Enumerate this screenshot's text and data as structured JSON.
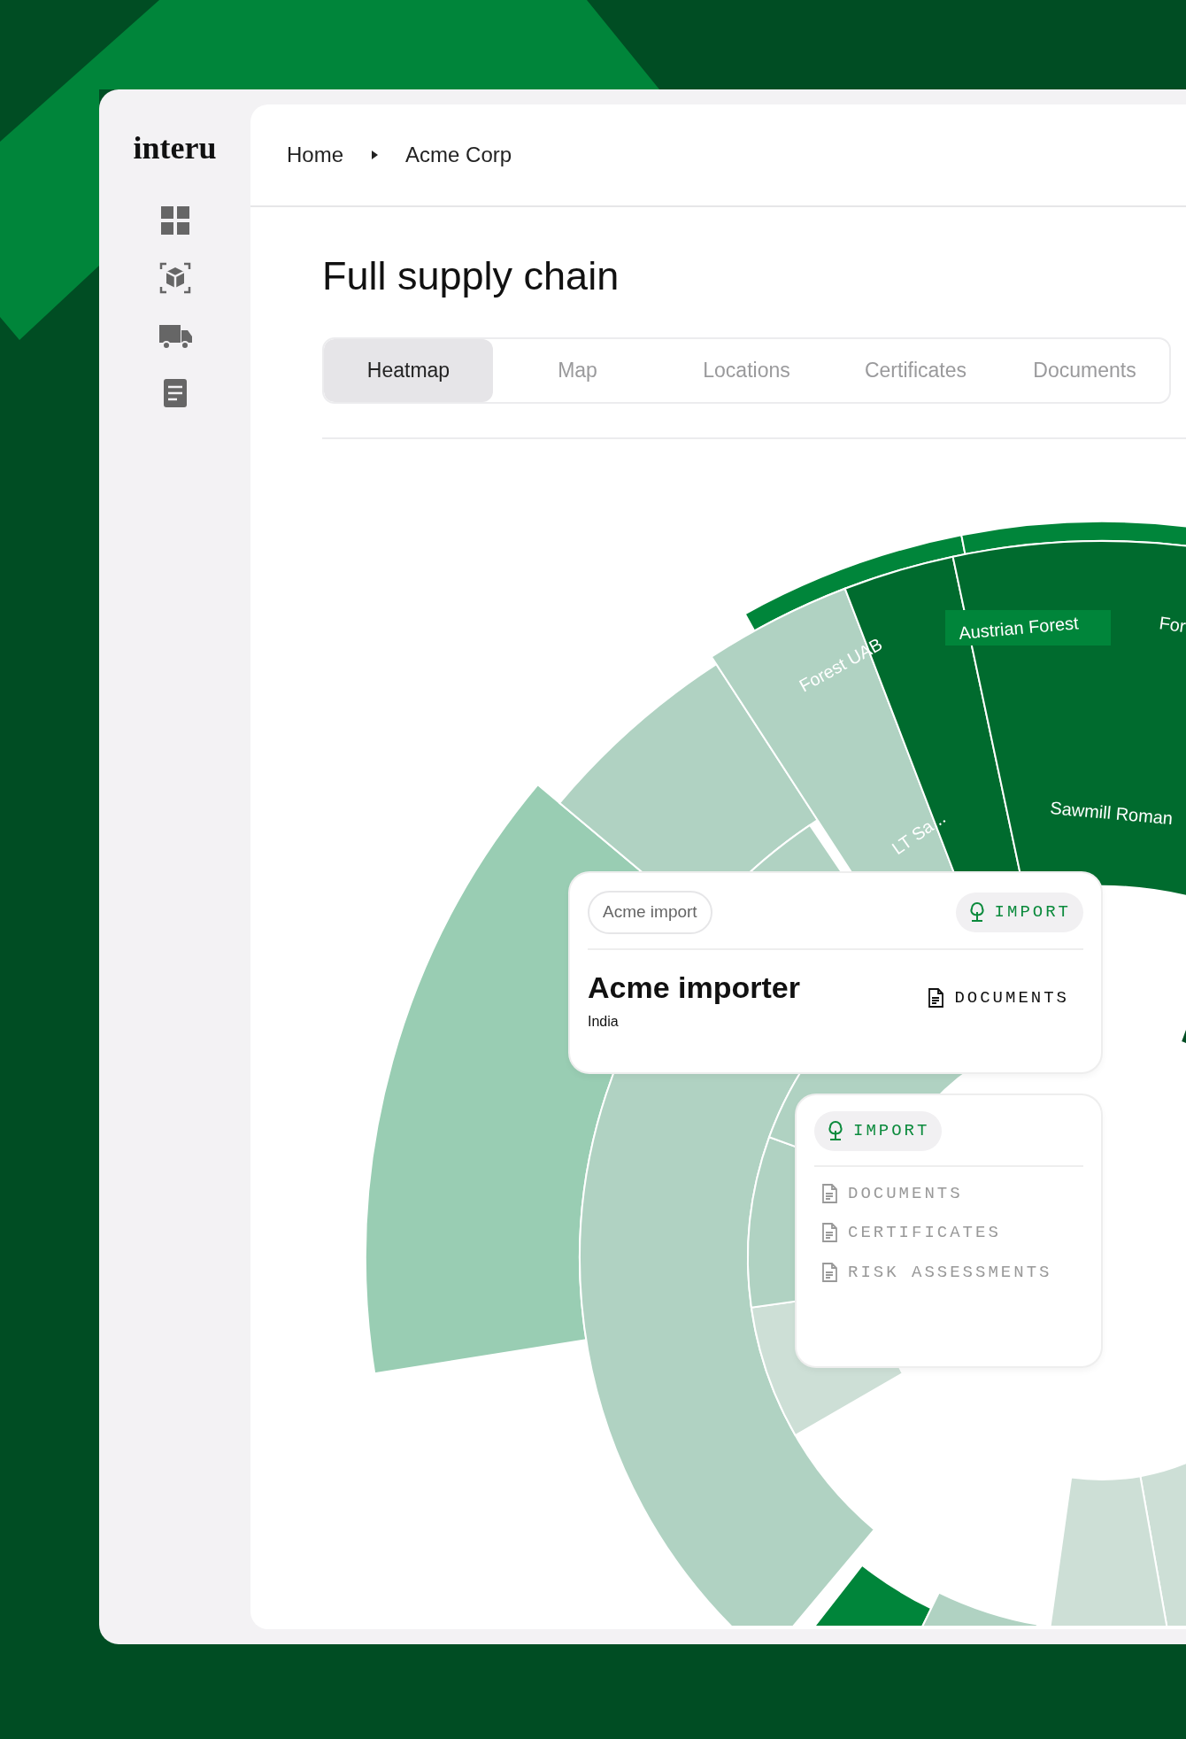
{
  "logo": "interu",
  "breadcrumb": [
    "Home",
    "Acme Corp"
  ],
  "title": "Full supply chain",
  "tabs": [
    {
      "label": "Heatmap",
      "selected": true
    },
    {
      "label": "Map",
      "selected": false
    },
    {
      "label": "Locations",
      "selected": false
    },
    {
      "label": "Certificates",
      "selected": false
    },
    {
      "label": "Documents",
      "selected": false
    }
  ],
  "sunburst": {
    "labels": [
      "Forest UAB",
      "Austrian Forest",
      "For",
      "Sawmill Roman",
      "LT Sa..."
    ]
  },
  "node_card": {
    "tag": "Acme import",
    "import_button": "IMPORT",
    "name": "Acme importer",
    "country": "India",
    "documents_button": "DOCUMENTS"
  },
  "menu_card": {
    "import_button": "IMPORT",
    "items": [
      {
        "label": "DOCUMENTS",
        "disabled": true
      },
      {
        "label": "CERTIFICATES",
        "disabled": true
      },
      {
        "label": "RISK ASSESSMENTS",
        "disabled": true
      }
    ]
  }
}
